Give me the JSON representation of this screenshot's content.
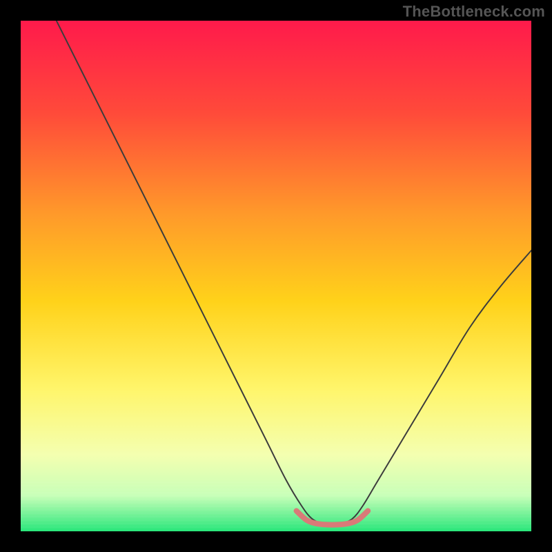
{
  "watermark": "TheBottleneck.com",
  "chart_data": {
    "type": "line",
    "title": "",
    "xlabel": "",
    "ylabel": "",
    "xlim": [
      0,
      100
    ],
    "ylim": [
      0,
      100
    ],
    "grid": false,
    "legend": null,
    "gradient_stops": [
      {
        "offset": 0.0,
        "color": "#ff1a4b"
      },
      {
        "offset": 0.18,
        "color": "#ff4a3a"
      },
      {
        "offset": 0.38,
        "color": "#ff9a2a"
      },
      {
        "offset": 0.55,
        "color": "#ffd21a"
      },
      {
        "offset": 0.72,
        "color": "#fff56a"
      },
      {
        "offset": 0.85,
        "color": "#f4ffb0"
      },
      {
        "offset": 0.93,
        "color": "#c8ffb8"
      },
      {
        "offset": 1.0,
        "color": "#28e67a"
      }
    ],
    "series": [
      {
        "name": "bottleneck-curve",
        "stroke": "#3c3c3c",
        "stroke_width": 2.0,
        "x": [
          7,
          12,
          18,
          24,
          30,
          36,
          42,
          48,
          52,
          55,
          57,
          59,
          61,
          63,
          65,
          67,
          70,
          76,
          82,
          88,
          94,
          100
        ],
        "y": [
          100,
          90,
          78,
          66,
          54,
          42,
          30,
          18,
          10,
          5,
          2.5,
          1.6,
          1.4,
          1.6,
          2.5,
          5,
          10,
          20,
          30,
          40,
          48,
          55
        ]
      },
      {
        "name": "optimal-range-highlight",
        "stroke": "#d97a78",
        "stroke_width": 8,
        "x": [
          54,
          56,
          58,
          60,
          62,
          64,
          66,
          68
        ],
        "y": [
          4.0,
          2.2,
          1.5,
          1.3,
          1.3,
          1.5,
          2.2,
          4.0
        ]
      }
    ]
  }
}
